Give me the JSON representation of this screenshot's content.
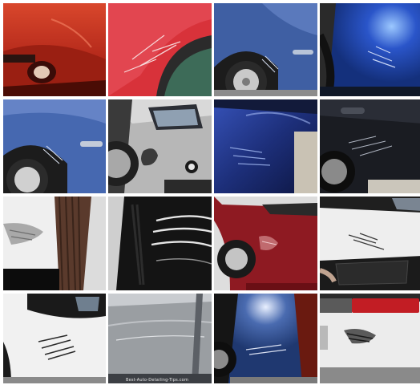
{
  "grid": {
    "rows": 4,
    "columns": 4,
    "tiles": [
      {
        "subject": "red car front bumper with headlight, scratched",
        "color": "#b3281a"
      },
      {
        "subject": "red car rear quarter panel with white scratch marks",
        "color": "#d8323a"
      },
      {
        "subject": "blue car rear wheel arch with scratches near wheel",
        "color": "#3f5fa3"
      },
      {
        "subject": "bright blue car bumper with scuffs",
        "color": "#2a55c9"
      },
      {
        "subject": "blue car wheel arch scratch close-up",
        "color": "#4668b0"
      },
      {
        "subject": "silver car front with dark scuff patch on bumper",
        "color": "#b7b7b7"
      },
      {
        "subject": "dark blue car bumper with scrapes",
        "color": "#1d2f7a"
      },
      {
        "subject": "black car door with scratches",
        "color": "#1a1c22"
      },
      {
        "subject": "white bumper scuff next to tire",
        "color": "#dcdcdc"
      },
      {
        "subject": "black glossy bumper with scratch close-up",
        "color": "#141414"
      },
      {
        "subject": "dark red car bumper with scuff",
        "color": "#8e1a22"
      },
      {
        "subject": "white car bumper with small scratches",
        "color": "#eeeeee"
      },
      {
        "subject": "white car front with scratch marks",
        "color": "#f1f1f1"
      },
      {
        "subject": "silver car door with long scratch",
        "color": "#9a9ea2"
      },
      {
        "subject": "blue car rear with scuffed bumper",
        "color": "#2b4c8e"
      },
      {
        "subject": "white car rear bumper with scrape marks",
        "color": "#ececec"
      }
    ]
  },
  "watermark": "Best-Auto-Detailing-Tips.com"
}
